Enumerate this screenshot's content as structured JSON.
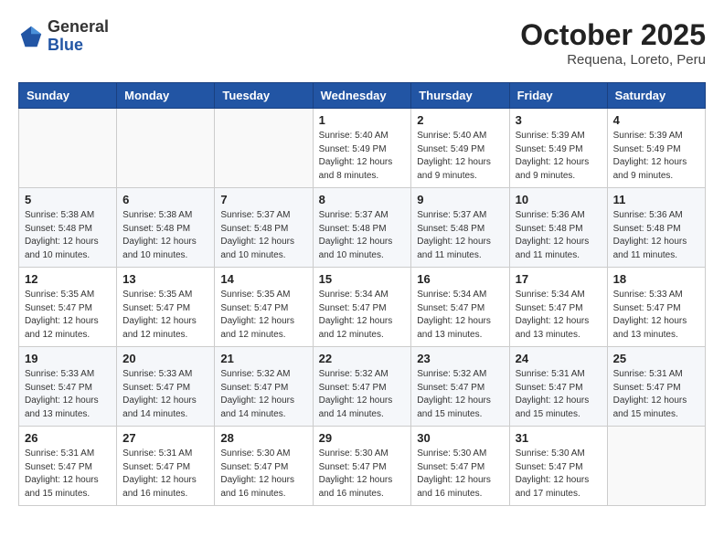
{
  "header": {
    "logo_general": "General",
    "logo_blue": "Blue",
    "month_title": "October 2025",
    "location": "Requena, Loreto, Peru"
  },
  "weekdays": [
    "Sunday",
    "Monday",
    "Tuesday",
    "Wednesday",
    "Thursday",
    "Friday",
    "Saturday"
  ],
  "weeks": [
    [
      {
        "day": "",
        "info": ""
      },
      {
        "day": "",
        "info": ""
      },
      {
        "day": "",
        "info": ""
      },
      {
        "day": "1",
        "info": "Sunrise: 5:40 AM\nSunset: 5:49 PM\nDaylight: 12 hours\nand 8 minutes."
      },
      {
        "day": "2",
        "info": "Sunrise: 5:40 AM\nSunset: 5:49 PM\nDaylight: 12 hours\nand 9 minutes."
      },
      {
        "day": "3",
        "info": "Sunrise: 5:39 AM\nSunset: 5:49 PM\nDaylight: 12 hours\nand 9 minutes."
      },
      {
        "day": "4",
        "info": "Sunrise: 5:39 AM\nSunset: 5:49 PM\nDaylight: 12 hours\nand 9 minutes."
      }
    ],
    [
      {
        "day": "5",
        "info": "Sunrise: 5:38 AM\nSunset: 5:48 PM\nDaylight: 12 hours\nand 10 minutes."
      },
      {
        "day": "6",
        "info": "Sunrise: 5:38 AM\nSunset: 5:48 PM\nDaylight: 12 hours\nand 10 minutes."
      },
      {
        "day": "7",
        "info": "Sunrise: 5:37 AM\nSunset: 5:48 PM\nDaylight: 12 hours\nand 10 minutes."
      },
      {
        "day": "8",
        "info": "Sunrise: 5:37 AM\nSunset: 5:48 PM\nDaylight: 12 hours\nand 10 minutes."
      },
      {
        "day": "9",
        "info": "Sunrise: 5:37 AM\nSunset: 5:48 PM\nDaylight: 12 hours\nand 11 minutes."
      },
      {
        "day": "10",
        "info": "Sunrise: 5:36 AM\nSunset: 5:48 PM\nDaylight: 12 hours\nand 11 minutes."
      },
      {
        "day": "11",
        "info": "Sunrise: 5:36 AM\nSunset: 5:48 PM\nDaylight: 12 hours\nand 11 minutes."
      }
    ],
    [
      {
        "day": "12",
        "info": "Sunrise: 5:35 AM\nSunset: 5:47 PM\nDaylight: 12 hours\nand 12 minutes."
      },
      {
        "day": "13",
        "info": "Sunrise: 5:35 AM\nSunset: 5:47 PM\nDaylight: 12 hours\nand 12 minutes."
      },
      {
        "day": "14",
        "info": "Sunrise: 5:35 AM\nSunset: 5:47 PM\nDaylight: 12 hours\nand 12 minutes."
      },
      {
        "day": "15",
        "info": "Sunrise: 5:34 AM\nSunset: 5:47 PM\nDaylight: 12 hours\nand 12 minutes."
      },
      {
        "day": "16",
        "info": "Sunrise: 5:34 AM\nSunset: 5:47 PM\nDaylight: 12 hours\nand 13 minutes."
      },
      {
        "day": "17",
        "info": "Sunrise: 5:34 AM\nSunset: 5:47 PM\nDaylight: 12 hours\nand 13 minutes."
      },
      {
        "day": "18",
        "info": "Sunrise: 5:33 AM\nSunset: 5:47 PM\nDaylight: 12 hours\nand 13 minutes."
      }
    ],
    [
      {
        "day": "19",
        "info": "Sunrise: 5:33 AM\nSunset: 5:47 PM\nDaylight: 12 hours\nand 13 minutes."
      },
      {
        "day": "20",
        "info": "Sunrise: 5:33 AM\nSunset: 5:47 PM\nDaylight: 12 hours\nand 14 minutes."
      },
      {
        "day": "21",
        "info": "Sunrise: 5:32 AM\nSunset: 5:47 PM\nDaylight: 12 hours\nand 14 minutes."
      },
      {
        "day": "22",
        "info": "Sunrise: 5:32 AM\nSunset: 5:47 PM\nDaylight: 12 hours\nand 14 minutes."
      },
      {
        "day": "23",
        "info": "Sunrise: 5:32 AM\nSunset: 5:47 PM\nDaylight: 12 hours\nand 15 minutes."
      },
      {
        "day": "24",
        "info": "Sunrise: 5:31 AM\nSunset: 5:47 PM\nDaylight: 12 hours\nand 15 minutes."
      },
      {
        "day": "25",
        "info": "Sunrise: 5:31 AM\nSunset: 5:47 PM\nDaylight: 12 hours\nand 15 minutes."
      }
    ],
    [
      {
        "day": "26",
        "info": "Sunrise: 5:31 AM\nSunset: 5:47 PM\nDaylight: 12 hours\nand 15 minutes."
      },
      {
        "day": "27",
        "info": "Sunrise: 5:31 AM\nSunset: 5:47 PM\nDaylight: 12 hours\nand 16 minutes."
      },
      {
        "day": "28",
        "info": "Sunrise: 5:30 AM\nSunset: 5:47 PM\nDaylight: 12 hours\nand 16 minutes."
      },
      {
        "day": "29",
        "info": "Sunrise: 5:30 AM\nSunset: 5:47 PM\nDaylight: 12 hours\nand 16 minutes."
      },
      {
        "day": "30",
        "info": "Sunrise: 5:30 AM\nSunset: 5:47 PM\nDaylight: 12 hours\nand 16 minutes."
      },
      {
        "day": "31",
        "info": "Sunrise: 5:30 AM\nSunset: 5:47 PM\nDaylight: 12 hours\nand 17 minutes."
      },
      {
        "day": "",
        "info": ""
      }
    ]
  ]
}
